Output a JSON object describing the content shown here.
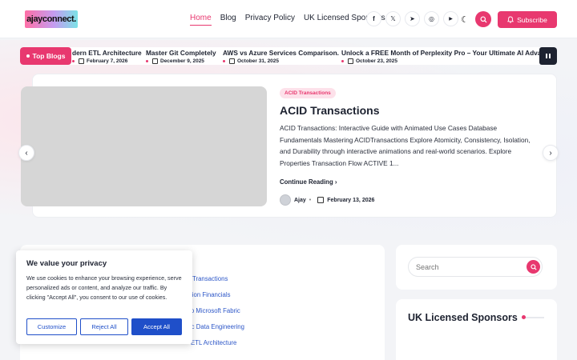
{
  "header": {
    "logo_text": "ajayconnect.",
    "nav": [
      {
        "label": "Home",
        "active": true
      },
      {
        "label": "Blog",
        "active": false
      },
      {
        "label": "Privacy Policy",
        "active": false
      },
      {
        "label": "UK Licensed Sponsors",
        "active": false
      }
    ],
    "socials": [
      {
        "name": "facebook-icon",
        "glyph": "f"
      },
      {
        "name": "x-icon",
        "glyph": "𝕏"
      },
      {
        "name": "telegram-icon",
        "glyph": "➤"
      },
      {
        "name": "instagram-icon",
        "glyph": "◎"
      },
      {
        "name": "youtube-icon",
        "glyph": "▶"
      }
    ],
    "theme_glyph": "☾",
    "subscribe_label": "Subscribe"
  },
  "ticker": {
    "label": "Top Blogs",
    "items": [
      {
        "title": "dern ETL Architecture",
        "date": "February 7, 2026"
      },
      {
        "title": "Master Git Completely",
        "date": "December 9, 2025"
      },
      {
        "title": "AWS vs Azure Services Comparison.",
        "date": "October 31, 2025"
      },
      {
        "title": "Unlock a FREE Month of Perplexity Pro – Your Ultimate AI Advanta",
        "date": "October 23, 2025"
      }
    ]
  },
  "hero": {
    "tag": "ACID Transactions",
    "title": "ACID Transactions",
    "excerpt": "ACID Transactions: Interactive Guide with Animated Use Cases Database Fundamentals Mastering ACIDTransactions Explore Atomicity, Consistency, Isolation, and Durability through interactive animations and real-world scenarios. Explore Properties Transaction Flow ACTIVE 1...",
    "read_more": "Continue Reading",
    "author": "Ajay",
    "date": "February 13, 2026"
  },
  "list_links": [
    "Transactions",
    "ssion Financials",
    "ta to Microsoft Fabric",
    "bric Data Engineering",
    "ETL Architecture"
  ],
  "sidebar": {
    "search_placeholder": "Search",
    "sponsors_title": "UK Licensed Sponsors"
  },
  "cookie": {
    "title": "We value your privacy",
    "text": "We use cookies to enhance your browsing experience, serve personalized ads or content, and analyze our traffic. By clicking \"Accept All\", you consent to our use of cookies.",
    "customize": "Customize",
    "reject": "Reject All",
    "accept": "Accept All"
  },
  "colors": {
    "accent": "#e8386f",
    "cookie_blue": "#1f4fc9",
    "dark": "#1d2230"
  }
}
